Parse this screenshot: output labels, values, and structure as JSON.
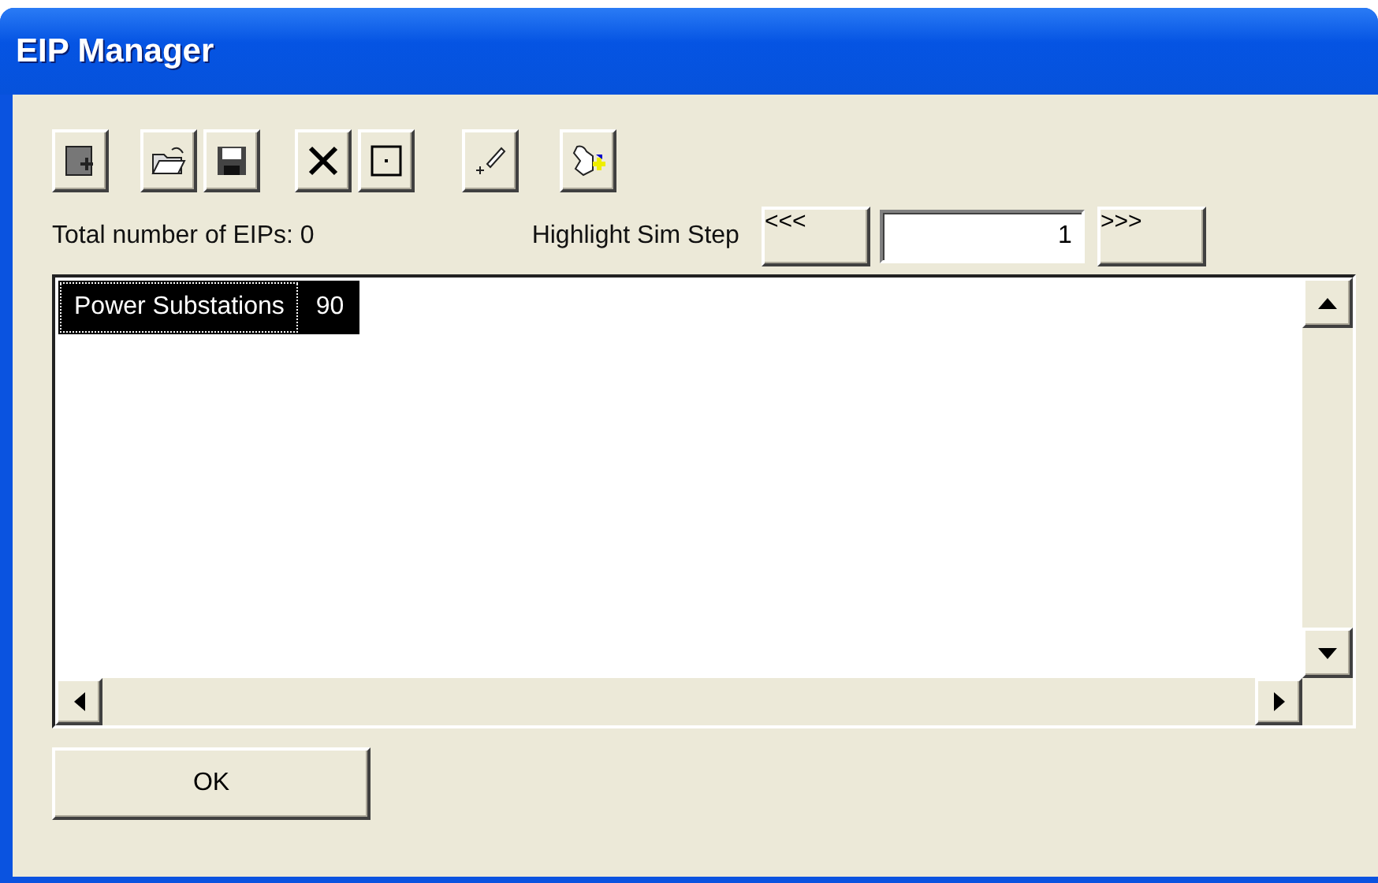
{
  "window": {
    "title": "EIP Manager"
  },
  "total_label": "Total number of EIPs: 0",
  "highlight": {
    "label": "Highlight Sim Step",
    "prev": "<<<",
    "step": "1",
    "next": ">>>"
  },
  "list": {
    "rows": [
      {
        "cells": [
          "Power Substations",
          "90"
        ],
        "selected": true
      }
    ]
  },
  "buttons": [
    "OK"
  ]
}
